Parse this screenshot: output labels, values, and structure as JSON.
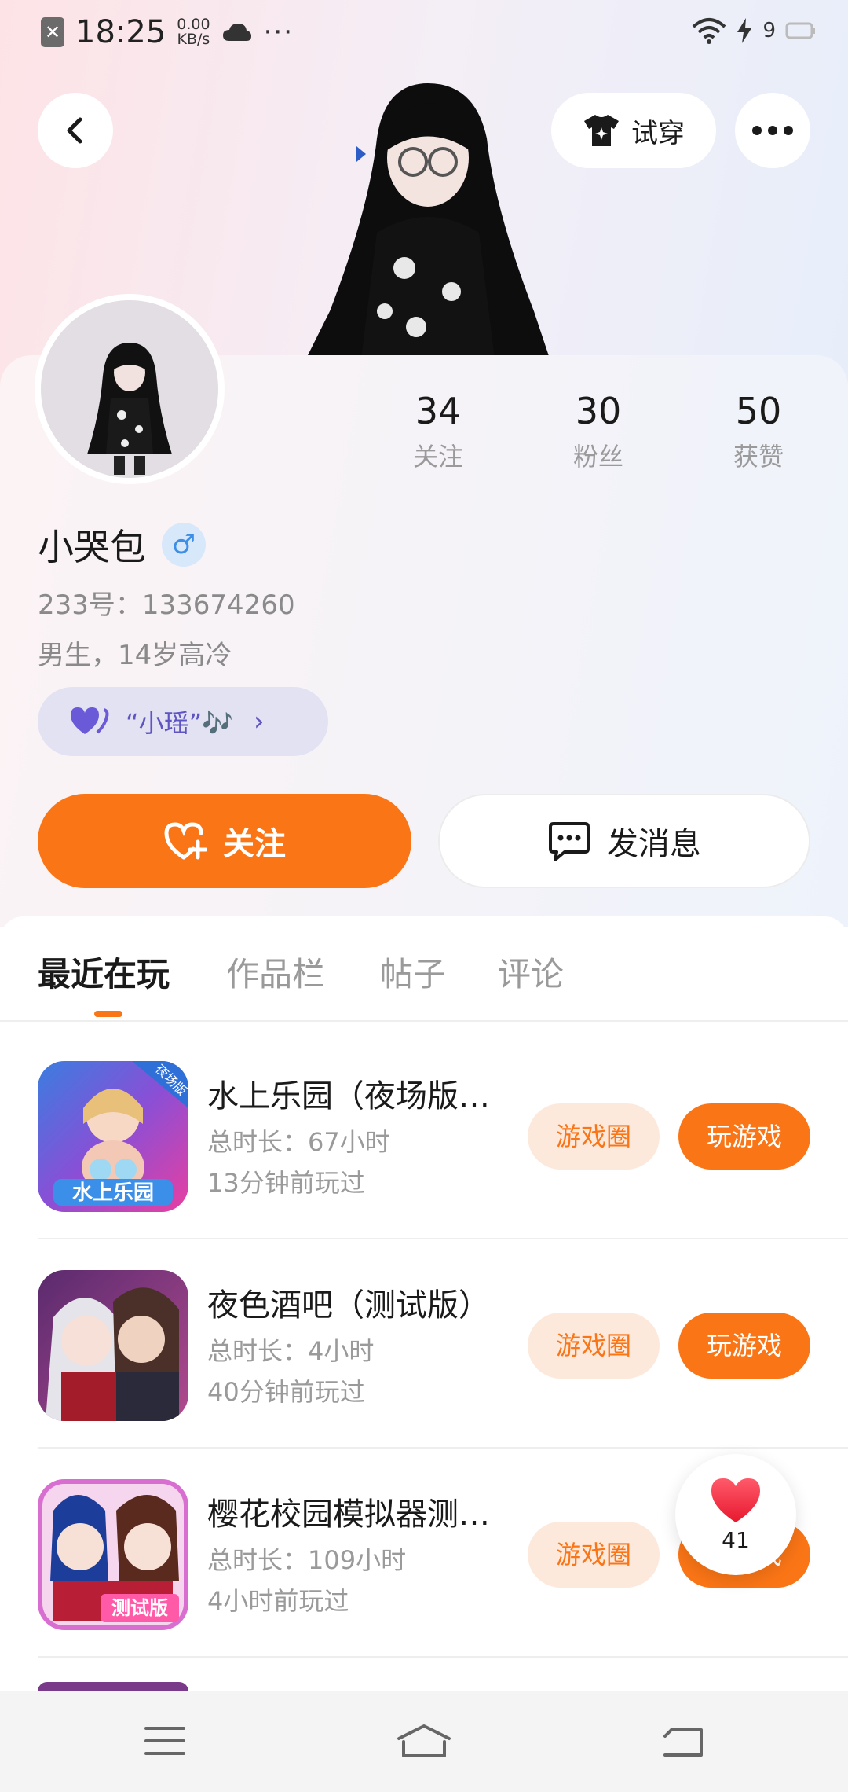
{
  "status_bar": {
    "time": "18:25",
    "speed_value": "0.00",
    "speed_unit": "KB/s",
    "more": "···",
    "battery": "9"
  },
  "top_actions": {
    "try_on_label": "试穿"
  },
  "profile": {
    "name": "小哭包",
    "gender_symbol": "♂",
    "id_text": "233号：133674260",
    "bio": "男生，14岁高冷",
    "tag_text": "“小瑶”🎶",
    "tag_arrow": "›",
    "stats": [
      {
        "value": "34",
        "label": "关注"
      },
      {
        "value": "30",
        "label": "粉丝"
      },
      {
        "value": "50",
        "label": "获赞"
      }
    ],
    "follow_label": "关注",
    "message_label": "发消息"
  },
  "tabs": [
    {
      "label": "最近在玩",
      "active": true
    },
    {
      "label": "作品栏",
      "active": false
    },
    {
      "label": "帖子",
      "active": false
    },
    {
      "label": "评论",
      "active": false
    }
  ],
  "games": [
    {
      "title": "水上乐园（夜场版…",
      "duration": "总时长：67小时",
      "last_played": "13分钟前玩过",
      "icon_text": "水上乐园",
      "icon_badge": "夜场版",
      "circle_label": "游戏圈",
      "play_label": "玩游戏"
    },
    {
      "title": "夜色酒吧（测试版）",
      "duration": "总时长：4小时",
      "last_played": "40分钟前玩过",
      "circle_label": "游戏圈",
      "play_label": "玩游戏"
    },
    {
      "title": "樱花校园模拟器测…",
      "duration": "总时长：109小时",
      "last_played": "4小时前玩过",
      "icon_text": "测试版",
      "circle_label": "游戏圈",
      "play_label": "玩游戏"
    }
  ],
  "like_float": {
    "count": "41"
  },
  "colors": {
    "accent": "#fa7516",
    "accent_light": "#fde9dc",
    "tag_bg": "#e3e2f3",
    "tag_text": "#5e55c2",
    "gender_blue": "#3c8ee6"
  }
}
